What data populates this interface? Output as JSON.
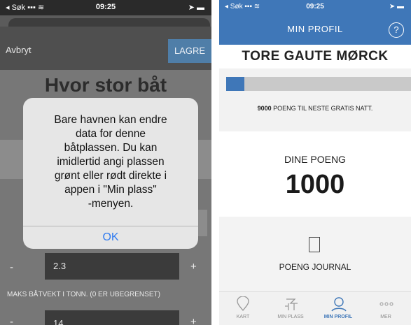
{
  "left": {
    "status": {
      "carrier": "◂ Søk ▪▪▪ ≋",
      "time": "09:25",
      "battery": "➤ ▬"
    },
    "nav": {
      "cancel": "Avbryt",
      "save": "LAGRE"
    },
    "heading": "Hvor stor båt",
    "alert": {
      "lines": [
        "Bare havnen kan endre",
        "data for denne",
        "båtplassen. Du kan",
        "imidlertid angi plassen",
        "grønt eller rødt direkte i",
        "appen i \"Min plass\"",
        "-menyen."
      ],
      "ok": "OK"
    },
    "stepper1": {
      "minus": "-",
      "value": "2.3",
      "plus": "+"
    },
    "weight_label": "MAKS BÅTVEKT I TONN. (0 ER UBEGRENSET)",
    "stepper2": {
      "minus": "-",
      "value": "14",
      "plus": "+"
    }
  },
  "right": {
    "status": {
      "carrier": "◂ Søk ▪▪▪ ≋",
      "time": "09:25",
      "battery": "➤ ▬"
    },
    "title": "MIN PROFIL",
    "help": "?",
    "name": "TORE GAUTE MØRCK",
    "progress": {
      "fraction": 0.1,
      "bold": "9000",
      "text": " POENG TIL NESTE GRATIS NATT."
    },
    "points": {
      "label": "DINE POENG",
      "value": "1000"
    },
    "journal": "POENG JOURNAL",
    "tabs": [
      {
        "label": "KART",
        "icon": "map-pin-icon"
      },
      {
        "label": "MIN PLASS",
        "icon": "boat-icon"
      },
      {
        "label": "MIN PROFIL",
        "icon": "user-icon"
      },
      {
        "label": "MER",
        "icon": "more-icon"
      }
    ],
    "accent": "#3f77b8"
  }
}
